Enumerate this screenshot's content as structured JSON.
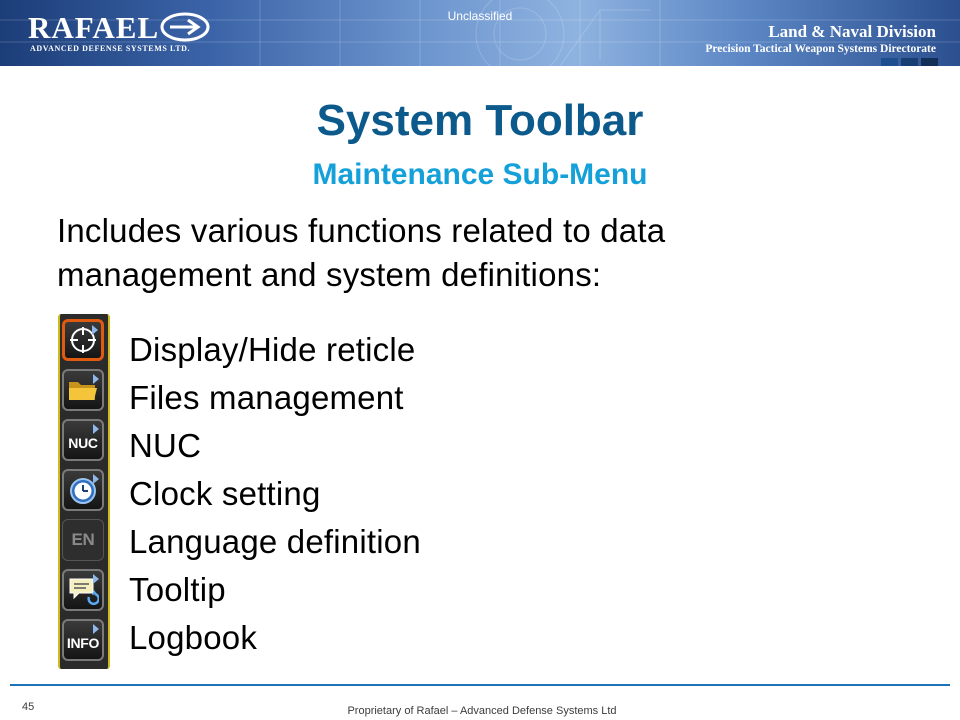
{
  "header": {
    "logo_text": "RAFAEL",
    "logo_subtitle": "ADVANCED DEFENSE SYSTEMS LTD.",
    "classification": "Unclassified",
    "division": "Land & Naval Division",
    "directorate": "Precision Tactical Weapon Systems Directorate"
  },
  "slide": {
    "title": "System Toolbar",
    "subtitle": "Maintenance Sub-Menu",
    "intro_line1": "Includes various functions related to data",
    "intro_line2": "management and system definitions:"
  },
  "toolbar_icons": [
    {
      "icon": "reticle-icon",
      "state": "active"
    },
    {
      "icon": "folder-icon",
      "state": "normal"
    },
    {
      "icon": "nuc-icon",
      "label": "NUC",
      "state": "normal"
    },
    {
      "icon": "clock-icon",
      "state": "normal"
    },
    {
      "icon": "language-icon",
      "label": "EN",
      "state": "disabled"
    },
    {
      "icon": "tooltip-icon",
      "state": "normal"
    },
    {
      "icon": "info-icon",
      "label": "INFO",
      "state": "normal"
    }
  ],
  "items": [
    "Display/Hide reticle",
    "Files management",
    "NUC",
    "Clock setting",
    "Language definition",
    "Tooltip",
    "Logbook"
  ],
  "footer": {
    "page_number": "45",
    "proprietary": "Proprietary of Rafael – Advanced Defense Systems Ltd"
  },
  "colors": {
    "title": "#0c5a8c",
    "subtitle": "#14a0d8",
    "footer_line": "#1e73b8",
    "active_border": "#e05a12",
    "strip_border": "#cdbb1c"
  }
}
